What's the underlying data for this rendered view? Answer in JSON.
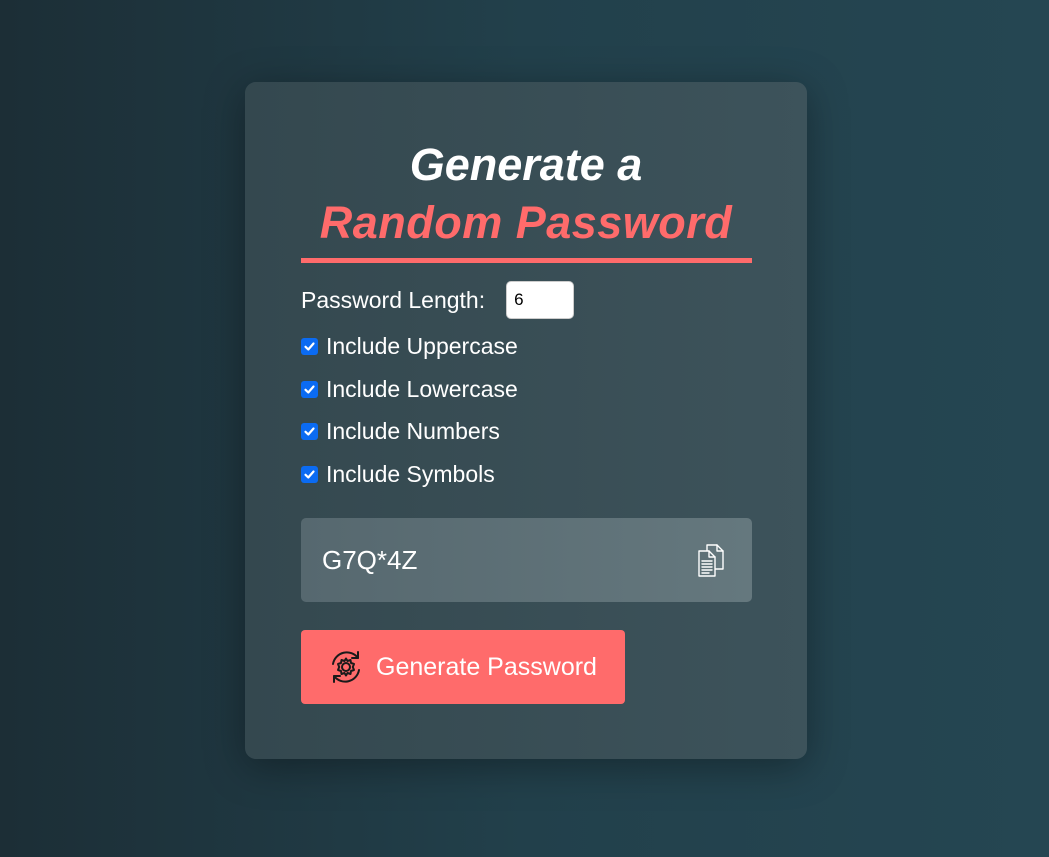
{
  "heading": {
    "line1": "Generate a",
    "line2": "Random Password"
  },
  "length": {
    "label": "Password Length:",
    "value": "6"
  },
  "options": [
    {
      "label": "Include Uppercase",
      "checked": true
    },
    {
      "label": "Include Lowercase",
      "checked": true
    },
    {
      "label": "Include Numbers",
      "checked": true
    },
    {
      "label": "Include Symbols",
      "checked": true
    }
  ],
  "result": {
    "password": "G7Q*4Z",
    "copy_icon": "copy-icon"
  },
  "generate_button": {
    "label": "Generate Password",
    "icon": "refresh-gear-icon"
  },
  "colors": {
    "accent": "#ff6b6b",
    "checkbox": "#0b6bf2"
  }
}
